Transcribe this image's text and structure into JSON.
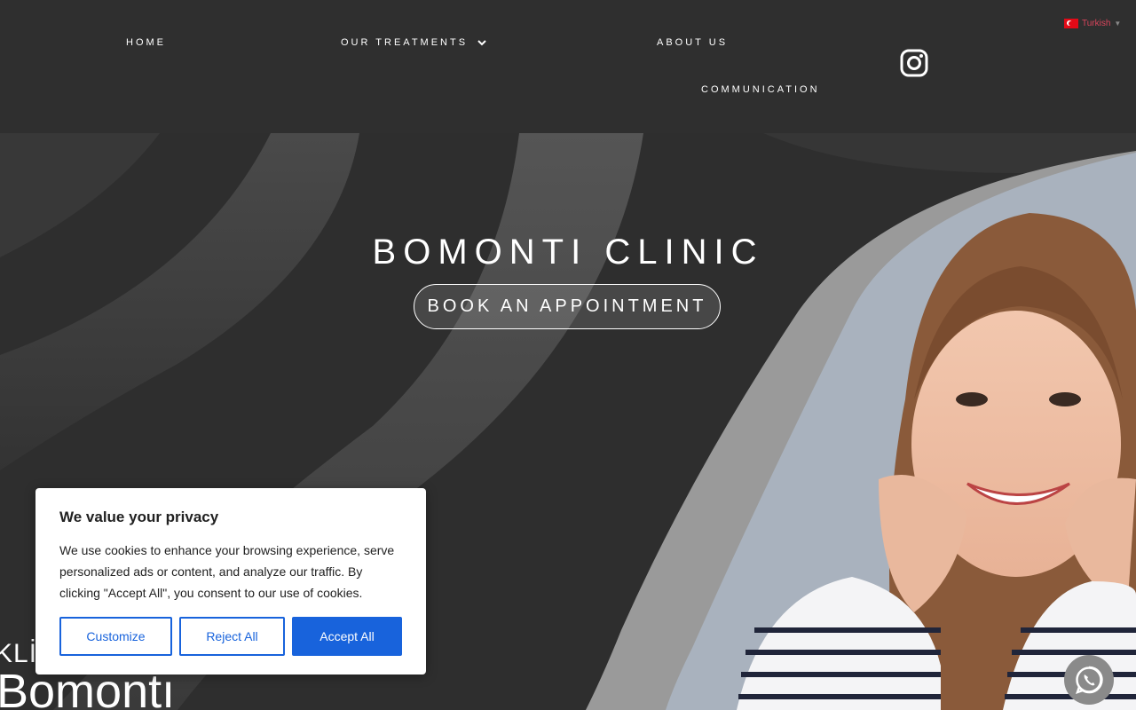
{
  "nav": {
    "home": "HOME",
    "treatments": "OUR TREATMENTS",
    "about": "ABOUT US",
    "communication": "COMMUNICATION"
  },
  "language": {
    "label": "Turkish",
    "flag": "tr-flag-icon"
  },
  "social": {
    "icon": "instagram-icon"
  },
  "hero": {
    "title": "BOMONTI CLINIC",
    "button": "BOOK AN APPOINTMENT",
    "brand_small": "KLİ",
    "brand_big": "Bomontı"
  },
  "cookie": {
    "title": "We value your privacy",
    "text": "We use cookies to enhance your browsing experience, serve personalized ads or content, and analyze our traffic. By clicking \"Accept All\", you consent to our use of cookies.",
    "customize": "Customize",
    "reject": "Reject All",
    "accept": "Accept All"
  },
  "colors": {
    "background": "#2e2e2e",
    "accent": "#1863dc",
    "photo_bg": "#a9b2be"
  },
  "whatsapp": {
    "icon": "whatsapp-icon"
  }
}
